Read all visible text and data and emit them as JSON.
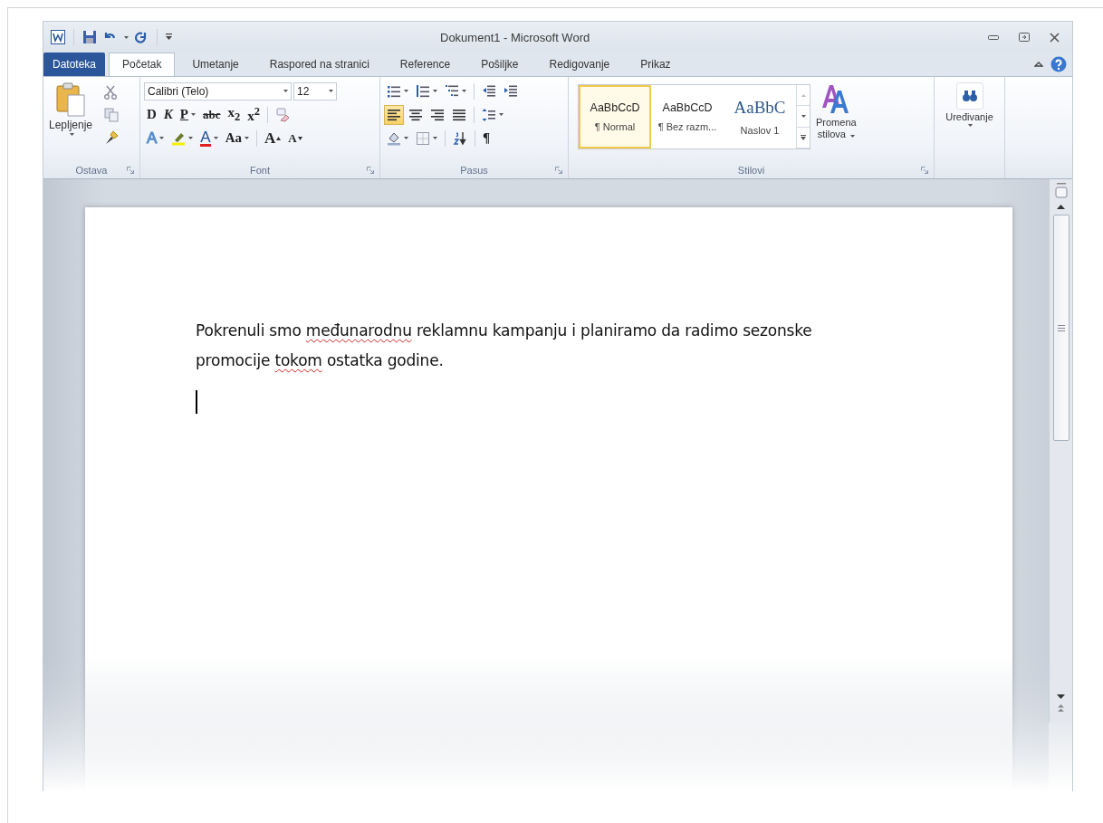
{
  "window": {
    "title": "Dokument1 - Microsoft Word"
  },
  "tabs": [
    {
      "label": "Datoteka",
      "kind": "file",
      "selected": false
    },
    {
      "label": "Početak",
      "kind": "tab",
      "selected": true
    },
    {
      "label": "Umetanje",
      "kind": "tab",
      "selected": false
    },
    {
      "label": "Raspored na stranici",
      "kind": "tab",
      "selected": false
    },
    {
      "label": "Reference",
      "kind": "tab",
      "selected": false
    },
    {
      "label": "Pošiljke",
      "kind": "tab",
      "selected": false
    },
    {
      "label": "Redigovanje",
      "kind": "tab",
      "selected": false
    },
    {
      "label": "Prikaz",
      "kind": "tab",
      "selected": false
    }
  ],
  "clipboard": {
    "label": "Ostava",
    "paste_label": "Lepljenje"
  },
  "font": {
    "label": "Font",
    "font_name": "Calibri (Telo)",
    "font_size": "12",
    "row2": [
      {
        "kind": "bold",
        "label": "D",
        "dropdown": false
      },
      {
        "kind": "italic",
        "label": "K",
        "dropdown": false
      },
      {
        "kind": "underline",
        "label": "P",
        "dropdown": true
      },
      {
        "kind": "strike",
        "label": "abc",
        "dropdown": false
      },
      {
        "kind": "script",
        "label": "x$_{2}$",
        "dropdown": false
      },
      {
        "kind": "script",
        "label": "x$^{2}$",
        "dropdown": false
      },
      {
        "kind": "clear",
        "dropdown": false
      }
    ],
    "row3": [
      {
        "kind": "effects",
        "label": "A",
        "dropdown": true
      },
      {
        "kind": "highlight",
        "dropdown": true
      },
      {
        "kind": "color",
        "label": "A",
        "dropdown": true
      },
      {
        "kind": "case",
        "label": "Aa",
        "dropdown": true
      },
      {
        "kind": "grow",
        "label": "A",
        "dropdown": false
      },
      {
        "kind": "shrink",
        "label": "A",
        "dropdown": false
      }
    ]
  },
  "paragraph": {
    "label": "Pasus",
    "row1": [
      {
        "kind": "bullets",
        "dropdown": true
      },
      {
        "kind": "numbering",
        "dropdown": true
      },
      {
        "kind": "multilevel",
        "dropdown": true
      },
      {
        "kind": "outdent",
        "dropdown": false
      },
      {
        "kind": "indent",
        "dropdown": false
      }
    ],
    "alignment": [
      {
        "kind": "left",
        "selected": true
      },
      {
        "kind": "center",
        "selected": false
      },
      {
        "kind": "right",
        "selected": false
      },
      {
        "kind": "justify",
        "selected": false
      }
    ],
    "row2_extra": [
      {
        "kind": "spacing",
        "dropdown": true
      }
    ],
    "row3": [
      {
        "kind": "shading",
        "dropdown": true
      },
      {
        "kind": "borders",
        "dropdown": true
      },
      {
        "kind": "sort",
        "dropdown": false
      },
      {
        "kind": "pilcrow",
        "label": "¶",
        "dropdown": false
      }
    ]
  },
  "styles": {
    "label": "Stilovi",
    "change_label": "Promena",
    "change_label_2": "stilova",
    "gallery": [
      {
        "preview": "AaBbCcD",
        "name": "¶ Normal",
        "kind": "body",
        "selected": true
      },
      {
        "preview": "AaBbCcD",
        "name": "¶ Bez razm...",
        "kind": "body",
        "selected": false
      },
      {
        "preview": "AaBbC",
        "name": "Naslov 1",
        "kind": "heading",
        "selected": false
      }
    ]
  },
  "editing": {
    "label": "Uređivanje"
  },
  "document": {
    "segments": [
      {
        "text": "Pokrenuli smo ",
        "misspelled": false
      },
      {
        "text": "međunarodnu",
        "misspelled": true
      },
      {
        "text": " reklamnu kampanju i planiramo da radimo sezonske promocije ",
        "misspelled": false
      },
      {
        "text": "tokom",
        "misspelled": true
      },
      {
        "text": " ostatka godine.",
        "misspelled": false
      }
    ]
  }
}
